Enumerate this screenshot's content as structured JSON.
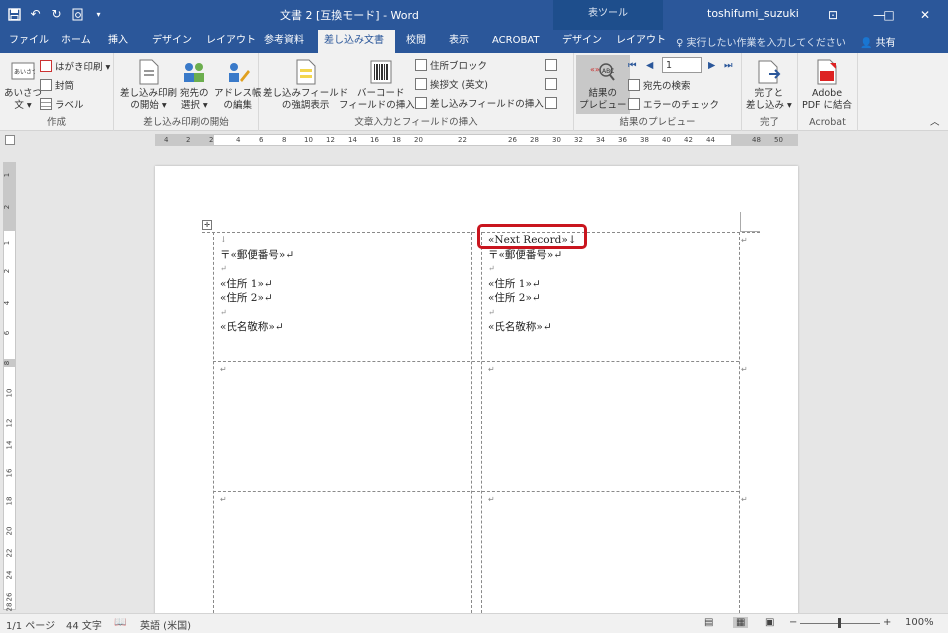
{
  "titlebar": {
    "title": "文書 2 [互換モード] - Word",
    "contextual_tab_group": "表ツール",
    "user": "toshifumi_suzuki",
    "minimize": "—",
    "restore": "□",
    "close": "✕",
    "ribbon_display": "⊡"
  },
  "qat": {
    "save_icon": "save-icon",
    "undo_icon": "undo-icon",
    "redo_icon": "redo-icon",
    "print_preview_icon": "print-preview-icon",
    "customize_icon": "dropdown-icon"
  },
  "tabs": [
    "ファイル",
    "ホーム",
    "挿入",
    "デザイン",
    "レイアウト",
    "参考資料",
    "差し込み文書",
    "校閲",
    "表示",
    "ACROBAT",
    "デザイン",
    "レイアウト"
  ],
  "active_tab": "差し込み文書",
  "tell_me": "実行したい作業を入力してください",
  "share": "共有",
  "ribbon": {
    "create": {
      "label": "作成",
      "greetings": [
        "あいさつ",
        "文 ▾"
      ],
      "postcard": "はがき印刷 ▾",
      "envelope": "封筒",
      "labels": "ラベル"
    },
    "start": {
      "label": "差し込み印刷の開始",
      "start_merge": [
        "差し込み印刷",
        "の開始 ▾"
      ],
      "select_recipients": [
        "宛先の",
        "選択 ▾"
      ],
      "edit_list": [
        "アドレス帳",
        "の編集"
      ]
    },
    "write": {
      "label": "文章入力とフィールドの挿入",
      "highlight": [
        "差し込みフィールド",
        "の強調表示"
      ],
      "barcode": [
        "バーコード",
        "フィールドの挿入 ▾"
      ],
      "address_block": "住所ブロック",
      "greeting_line": "挨拶文 (英文)",
      "insert_field": "差し込みフィールドの挿入 ▾"
    },
    "preview": {
      "label": "結果のプレビュー",
      "preview_results": [
        "結果の",
        "プレビュー"
      ],
      "record_number": "1",
      "find_recipient": "宛先の検索",
      "check_errors": "エラーのチェック"
    },
    "finish": {
      "label": "完了",
      "finish_merge": [
        "完了と",
        "差し込み ▾"
      ]
    },
    "acrobat": {
      "label": "Acrobat",
      "pdf_merge": [
        "Adobe",
        "PDF に結合"
      ]
    }
  },
  "hruler_numbers": [
    "4",
    "2",
    "2",
    "4",
    "6",
    "8",
    "10",
    "12",
    "14",
    "16",
    "18",
    "20",
    "22",
    "26",
    "28",
    "30",
    "32",
    "34",
    "36",
    "38",
    "40",
    "42",
    "44",
    "48",
    "50"
  ],
  "vruler_numbers": [
    "1",
    "2",
    "1",
    "2",
    "4",
    "6",
    "8",
    "10",
    "12",
    "14",
    "16",
    "18",
    "20",
    "22",
    "24",
    "26",
    "28"
  ],
  "document": {
    "cell1": [
      "↓",
      "〒«郵便番号»↵",
      "↵",
      "«住所 1»↵",
      "«住所 2»↵",
      "↵",
      "«氏名敬称»↵"
    ],
    "cell2": [
      "«Next Record»↓",
      "〒«郵便番号»↵",
      "↵",
      "«住所 1»↵",
      "«住所 2»↵",
      "↵",
      "«氏名敬称»↵"
    ],
    "row_end_mark": "↵",
    "cell_mark": "↵"
  },
  "status": {
    "page": "1/1 ページ",
    "words": "44 文字",
    "language": "英語 (米国)",
    "zoom": "100%",
    "zoom_minus": "−",
    "zoom_plus": "+"
  }
}
